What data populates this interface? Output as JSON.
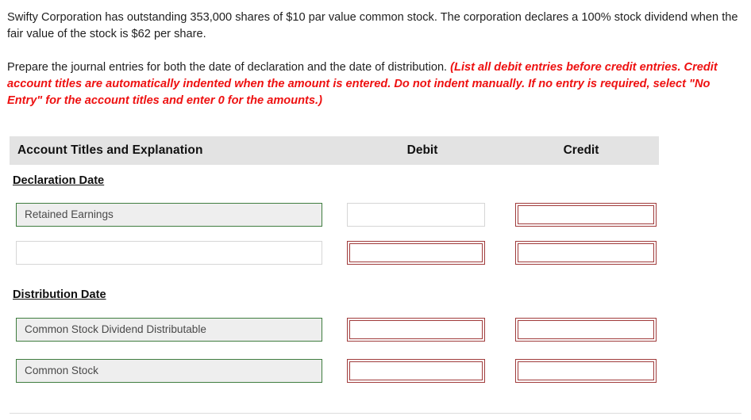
{
  "problem": {
    "statement": "Swifty Corporation has outstanding 353,000 shares of $10 par value common stock. The corporation declares a 100% stock dividend when the fair value of the stock is $62 per share.",
    "instruction_plain": "Prepare the journal entries for both the date of declaration and the date of distribution. ",
    "instruction_emphasis": "(List all debit entries before credit entries. Credit account titles are automatically indented when the amount is entered. Do not indent manually. If no entry is required, select \"No Entry\" for the account titles and enter 0 for the amounts.)"
  },
  "table": {
    "headers": {
      "account": "Account Titles and Explanation",
      "debit": "Debit",
      "credit": "Credit"
    },
    "sections": [
      {
        "label": "Declaration Date",
        "rows": [
          {
            "account": {
              "value": "Retained Earnings",
              "state": "filled"
            },
            "debit": {
              "value": "",
              "state": "empty"
            },
            "credit": {
              "value": "",
              "state": "flagged"
            }
          },
          {
            "account": {
              "value": "",
              "state": "empty"
            },
            "debit": {
              "value": "",
              "state": "flagged"
            },
            "credit": {
              "value": "",
              "state": "flagged"
            }
          }
        ]
      },
      {
        "label": "Distribution Date",
        "rows": [
          {
            "account": {
              "value": "Common Stock Dividend Distributable",
              "state": "filled"
            },
            "debit": {
              "value": "",
              "state": "flagged"
            },
            "credit": {
              "value": "",
              "state": "flagged"
            }
          },
          {
            "account": {
              "value": "Common Stock",
              "state": "filled"
            },
            "debit": {
              "value": "",
              "state": "flagged"
            },
            "credit": {
              "value": "",
              "state": "flagged"
            }
          }
        ]
      }
    ]
  },
  "colors": {
    "flagged_border": "#a03b3b",
    "filled_border": "#3f7d3f",
    "filled_fill": "#eeeeee",
    "header_band": "#e3e3e3",
    "emphasis_text": "#ee1111"
  }
}
